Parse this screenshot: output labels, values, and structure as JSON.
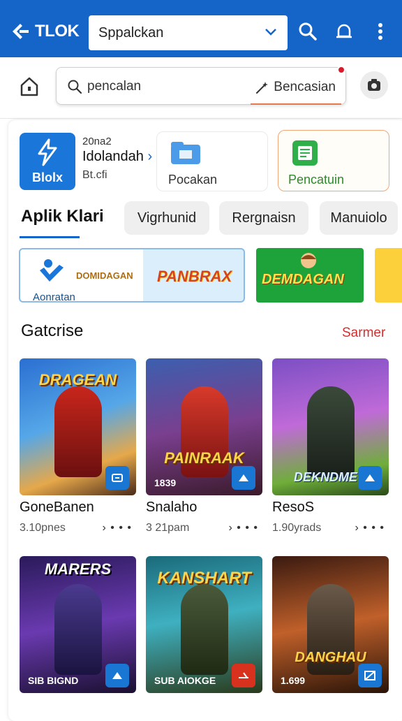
{
  "header": {
    "logo_text": "TLOK",
    "select_value": "Sppalckan",
    "accent": "#1565c9"
  },
  "search": {
    "query": "pencalan",
    "right_text": "Bencasian",
    "notify_color": "#d81b2a"
  },
  "featured": [
    {
      "tile_text": "Blolx",
      "small": "20na2",
      "title": "Idolandah",
      "sub": "Bt.cfi"
    },
    {
      "label": "Pocakan"
    },
    {
      "label": "Pencatuin"
    }
  ],
  "tabs": {
    "active": "Aplik Klari",
    "chips": [
      "Vigrhunid",
      "Rergnaisn",
      "Manuiolo"
    ]
  },
  "banners": [
    {
      "caption": "Aonratan",
      "title": "PANBRAX",
      "sub": "DOMIDAGAN"
    },
    {
      "title": "DEMDAGAN"
    }
  ],
  "section": {
    "title": "Gatcrise",
    "link": "Sarmer"
  },
  "games": [
    {
      "name": "GoneBanen",
      "meta": "3.10pnes",
      "thumb_title": "DRAGEAN",
      "stamp": "",
      "icons": [
        "game-icon"
      ]
    },
    {
      "name": "Snalaho",
      "meta": "3 21pam",
      "thumb_title": "PAINRAAK",
      "stamp": "1839",
      "icons": [
        "game-icon"
      ]
    },
    {
      "name": "ResoS",
      "meta": "1.90yrads",
      "thumb_title": "DEKNDMEG",
      "stamp": "",
      "icons": [
        "game-icon"
      ]
    },
    {
      "name": "",
      "meta": "",
      "thumb_title": "MARERS",
      "stamp": "SIB BIGND",
      "icons": [
        "game-icon"
      ]
    },
    {
      "name": "",
      "meta": "",
      "thumb_title": "KANSHART",
      "stamp": "SUB AIOKGE",
      "icons": [
        "game-icon"
      ]
    },
    {
      "name": "",
      "meta": "",
      "thumb_title": "DANGHAU",
      "stamp": "1.699",
      "icons": [
        "game-icon"
      ]
    }
  ],
  "meta_actions": "› • • •"
}
